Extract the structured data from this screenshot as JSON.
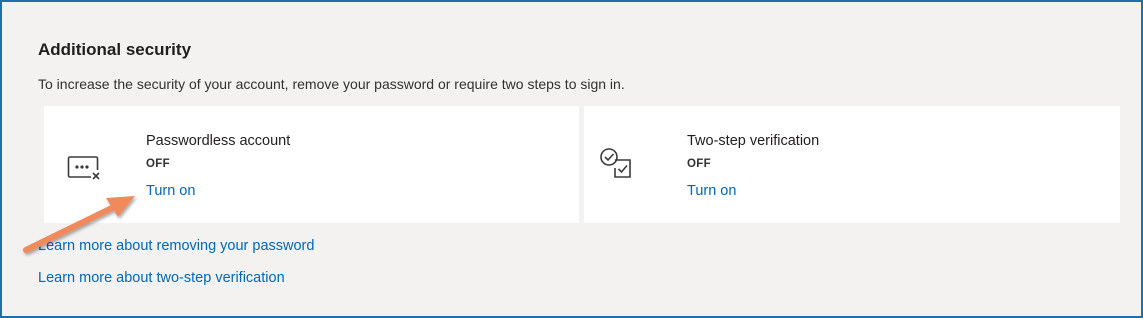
{
  "section": {
    "title": "Additional security",
    "description": "To increase the security of your account, remove your password or require two steps to sign in."
  },
  "cards": [
    {
      "icon": "password-dots-icon",
      "title": "Passwordless account",
      "status": "OFF",
      "action_label": "Turn on"
    },
    {
      "icon": "checklist-icon",
      "title": "Two-step verification",
      "status": "OFF",
      "action_label": "Turn on"
    }
  ],
  "links": {
    "remove_password": "Learn more about removing your password",
    "two_step": "Learn more about two-step verification"
  },
  "colors": {
    "background": "#f3f2f1",
    "card": "#ffffff",
    "link": "#0067b8",
    "frame_border": "#1f6fa8",
    "annotation_arrow": "#f08a5d"
  }
}
